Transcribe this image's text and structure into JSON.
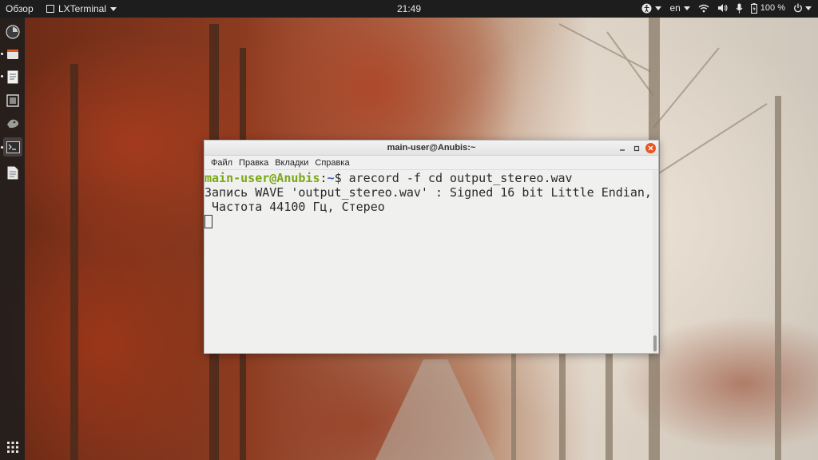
{
  "topbar": {
    "activities_label": "Обзор",
    "app_menu_label": "LXTerminal",
    "clock": "21:49",
    "keyboard_layout": "en",
    "battery_percent": "100 %",
    "icons": [
      "accessibility-icon",
      "wifi-icon",
      "volume-icon",
      "microphone-icon",
      "battery-icon",
      "power-icon"
    ]
  },
  "dock": {
    "items": [
      "browser-icon",
      "files-icon",
      "text-editor-icon",
      "screenshot-icon",
      "gimp-icon",
      "terminal-icon",
      "document-icon"
    ],
    "app_grid_icon": "app-grid-icon"
  },
  "window": {
    "title": "main-user@Anubis:~",
    "menu": [
      "Файл",
      "Правка",
      "Вкладки",
      "Справка"
    ],
    "terminal": {
      "prompt_user": "main-user@Anubis",
      "prompt_sep": ":",
      "prompt_path": "~",
      "prompt_symbol": "$ ",
      "command": "arecord -f cd output_stereo.wav",
      "output_line_1": "Запись WAVE 'output_stereo.wav' : Signed 16 bit Little Endian,",
      "output_line_2": " Частота 44100 Гц, Стерео"
    }
  },
  "colors": {
    "accent_orange": "#e95420",
    "prompt_user_green": "#7ba818",
    "prompt_path_blue": "#3a66b8"
  }
}
